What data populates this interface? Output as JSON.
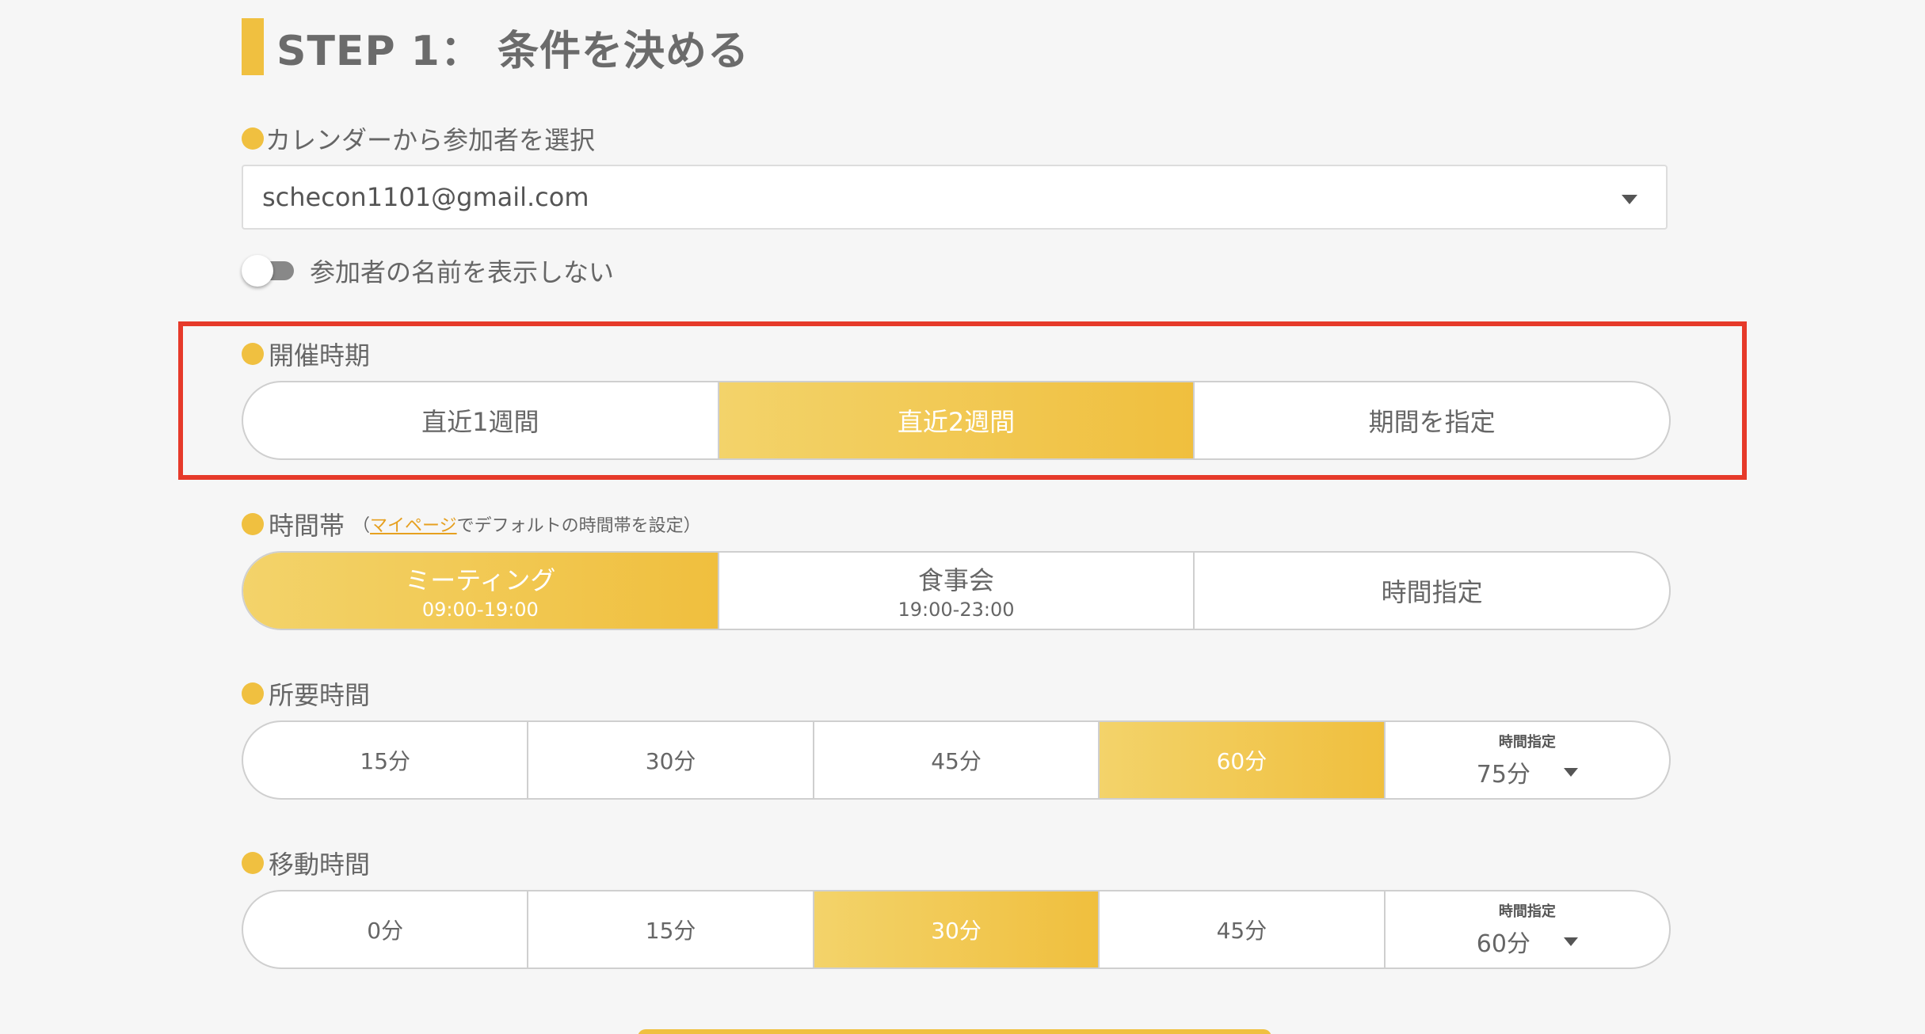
{
  "step": {
    "title": "STEP 1： 条件を決める"
  },
  "participants": {
    "label": "カレンダーから参加者を選択",
    "selected": "schecon1101@gmail.com",
    "toggle_label": "参加者の名前を表示しない",
    "toggle_on": false
  },
  "period": {
    "label": "開催時期",
    "options": [
      "直近1週間",
      "直近2週間",
      "期間を指定"
    ],
    "selected": "直近2週間"
  },
  "timeslot": {
    "label": "時間帯",
    "note_open": "（",
    "note_link": "マイページ",
    "note_rest": "でデフォルトの時間帯を設定）",
    "options": [
      {
        "title": "ミーティング",
        "sub": "09:00-19:00"
      },
      {
        "title": "食事会",
        "sub": "19:00-23:00"
      },
      {
        "title": "時間指定",
        "sub": ""
      }
    ],
    "selected": "ミーティング"
  },
  "duration": {
    "label": "所要時間",
    "options": [
      "15分",
      "30分",
      "45分",
      "60分"
    ],
    "selected": "60分",
    "custom_label": "時間指定",
    "custom_value": "75分"
  },
  "travel": {
    "label": "移動時間",
    "options": [
      "0分",
      "15分",
      "30分",
      "45分"
    ],
    "selected": "30分",
    "custom_label": "時間指定",
    "custom_value": "60分"
  },
  "colors": {
    "accent": "#f0c040",
    "highlight_border": "#e63a2a",
    "link": "#e6a020"
  }
}
